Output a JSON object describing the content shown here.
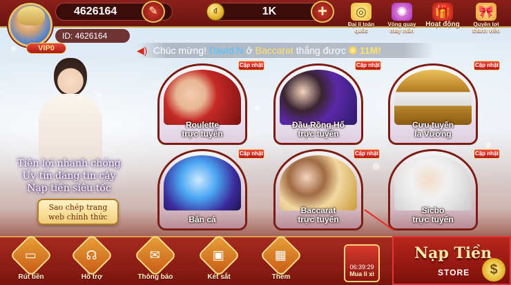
{
  "profile": {
    "balance": "4626164",
    "user_id": "ID: 4626164",
    "vip": "VIP0",
    "edit_icon": "✎"
  },
  "currency": {
    "amount": "1K",
    "plus_icon": "+",
    "coin_icon": "₫"
  },
  "top_menu": [
    {
      "label": "Đại lí toàn quốc",
      "icon": "◎"
    },
    {
      "label": "Vòng quay may mắn",
      "icon": "✺"
    },
    {
      "label": "Hoạt động",
      "icon": "🎁"
    },
    {
      "label": "Quyền lợi thành viên",
      "icon": "🎀"
    }
  ],
  "marquee": {
    "prefix": "Chúc mừng!",
    "name": "David.N",
    "connector": "ở",
    "game": "Baccarat",
    "suffix": "thắng được",
    "amount": "11M!"
  },
  "promo": {
    "line1": "Tiện lợi nhanh chóng",
    "line2": "Uy tín đáng tin cậy",
    "line3": "Nạp tiền siêu tốc",
    "copy_line1": "Sao chép trang",
    "copy_line2": "web chính thức"
  },
  "badge_update": "Cập nhật",
  "games": [
    {
      "line1": "Roulette",
      "line2": "trực tuyến"
    },
    {
      "line1": "Đầu Rồng Hổ",
      "line2": "trực tuyến"
    },
    {
      "line1": "Cưu tuyến",
      "line2": "la Vương"
    },
    {
      "line1": "Bắn cá",
      "line2": ""
    },
    {
      "line1": "Baccarat",
      "line2": "trực tuyến"
    },
    {
      "line1": "Sicbo",
      "line2": "trực tuyến"
    }
  ],
  "nav": [
    {
      "label": "Rút tiền",
      "icon": "▭"
    },
    {
      "label": "Hỗ trợ",
      "icon": "☊"
    },
    {
      "label": "Thông báo",
      "icon": "✉"
    },
    {
      "label": "Két sắt",
      "icon": "▣"
    },
    {
      "label": "Thêm",
      "icon": "▦"
    }
  ],
  "safe_buy": {
    "time": "06:39:29",
    "label": "Mua li xì"
  },
  "deposit": {
    "label": "Nạp Tiền",
    "store": "STORE",
    "coin": "$"
  },
  "colors": {
    "header_red": "#8b1f1a",
    "gold": "#e9c35a",
    "nav_red": "#a62a1f"
  }
}
